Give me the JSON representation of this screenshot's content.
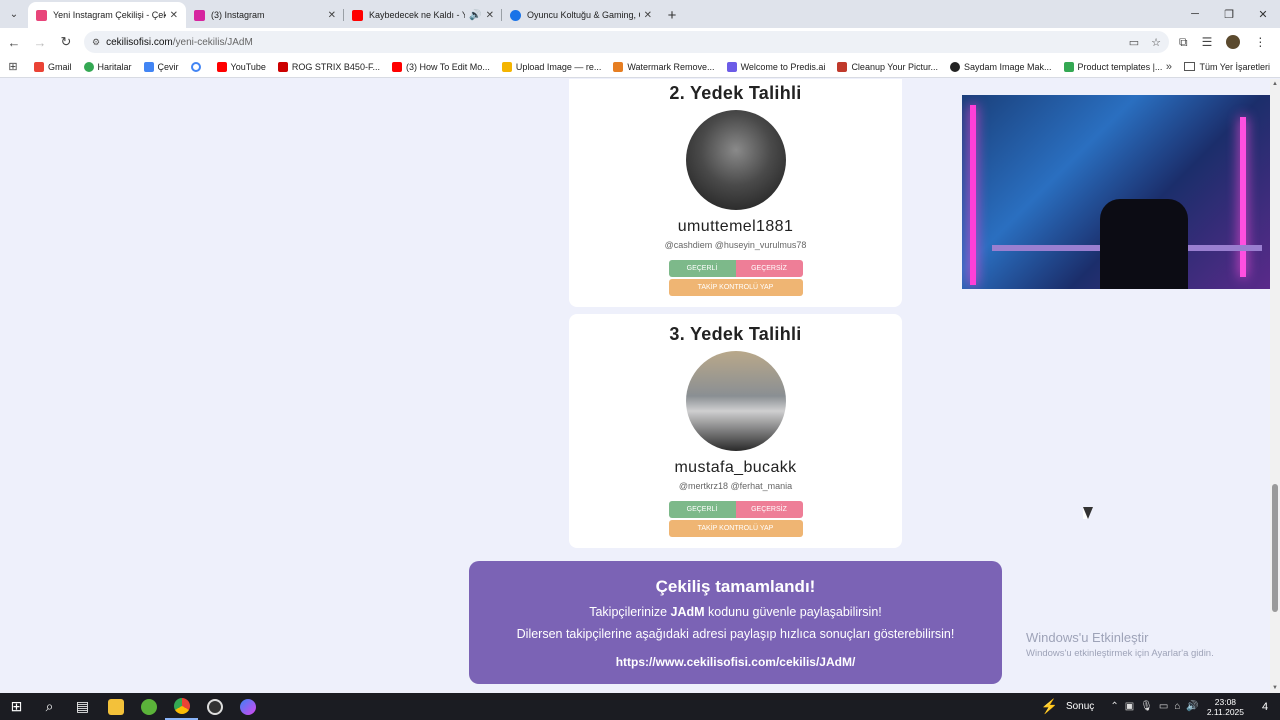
{
  "browser": {
    "tabs": [
      {
        "title": "Yeni Instagram Çekilişi - Çekiliş",
        "color": "#e8457a"
      },
      {
        "title": "(3) Instagram",
        "color": "#d6249f"
      },
      {
        "title": "Kaybedecek ne Kaldı - YouTube",
        "color": "#ff0000"
      },
      {
        "title": "Oyuncu Koltuğu & Gaming, Ga...",
        "color": "#1a73e8"
      }
    ],
    "url_host": "cekilisofisi.com",
    "url_path": "/yeni-cekilis/JAdM",
    "bookmarks": [
      {
        "label": "Gmail",
        "color": "#ea4335"
      },
      {
        "label": "Haritalar",
        "color": "#34a853"
      },
      {
        "label": "Çevir",
        "color": "#4285f4"
      },
      {
        "label": "",
        "color": "#4285f4"
      },
      {
        "label": "YouTube",
        "color": "#ff0000"
      },
      {
        "label": "ROG STRIX B450-F...",
        "color": "#c00"
      },
      {
        "label": "(3) How To Edit Mo...",
        "color": "#ff0000"
      },
      {
        "label": "Upload Image — re...",
        "color": "#f4b400"
      },
      {
        "label": "Watermark Remove...",
        "color": "#e67e22"
      },
      {
        "label": "Welcome to Predis.ai",
        "color": "#6c5ce7"
      },
      {
        "label": "Cleanup Your Pictur...",
        "color": "#c0392b"
      },
      {
        "label": "Saydam Image Mak...",
        "color": "#222"
      },
      {
        "label": "Product templates |...",
        "color": "#34a853"
      }
    ],
    "all_bookmarks": "Tüm Yer İşaretleri"
  },
  "winners": [
    {
      "title": "2. Yedek Talihli",
      "username": "umuttemel1881",
      "mentions": "@cashdiem @huseyin_vurulmus78",
      "valid_label": "GEÇERLİ",
      "invalid_label": "GEÇERSİZ",
      "follow_label": "TAKİP KONTROLÜ YAP"
    },
    {
      "title": "3. Yedek Talihli",
      "username": "mustafa_bucakk",
      "mentions": "@mertkrz18 @ferhat_mania",
      "valid_label": "GEÇERLİ",
      "invalid_label": "GEÇERSİZ",
      "follow_label": "TAKİP KONTROLÜ YAP"
    }
  ],
  "completion": {
    "heading": "Çekiliş tamamlandı!",
    "line1_prefix": "Takipçilerinize ",
    "code": "JAdM",
    "line1_suffix": " kodunu güvenle paylaşabilirsin!",
    "line2": "Dilersen takipçilerine aşağıdaki adresi paylaşıp hızlıca sonuçları gösterebilirsin!",
    "link": "https://www.cekilisofisi.com/cekilis/JAdM/"
  },
  "watermark": {
    "title": "Windows'u Etkinleştir",
    "subtitle": "Windows'u etkinleştirmek için Ayarlar'a gidin."
  },
  "taskbar": {
    "weather": "Sonuç",
    "time": "23:08",
    "date": "2.11.2025",
    "notifications": "4"
  }
}
